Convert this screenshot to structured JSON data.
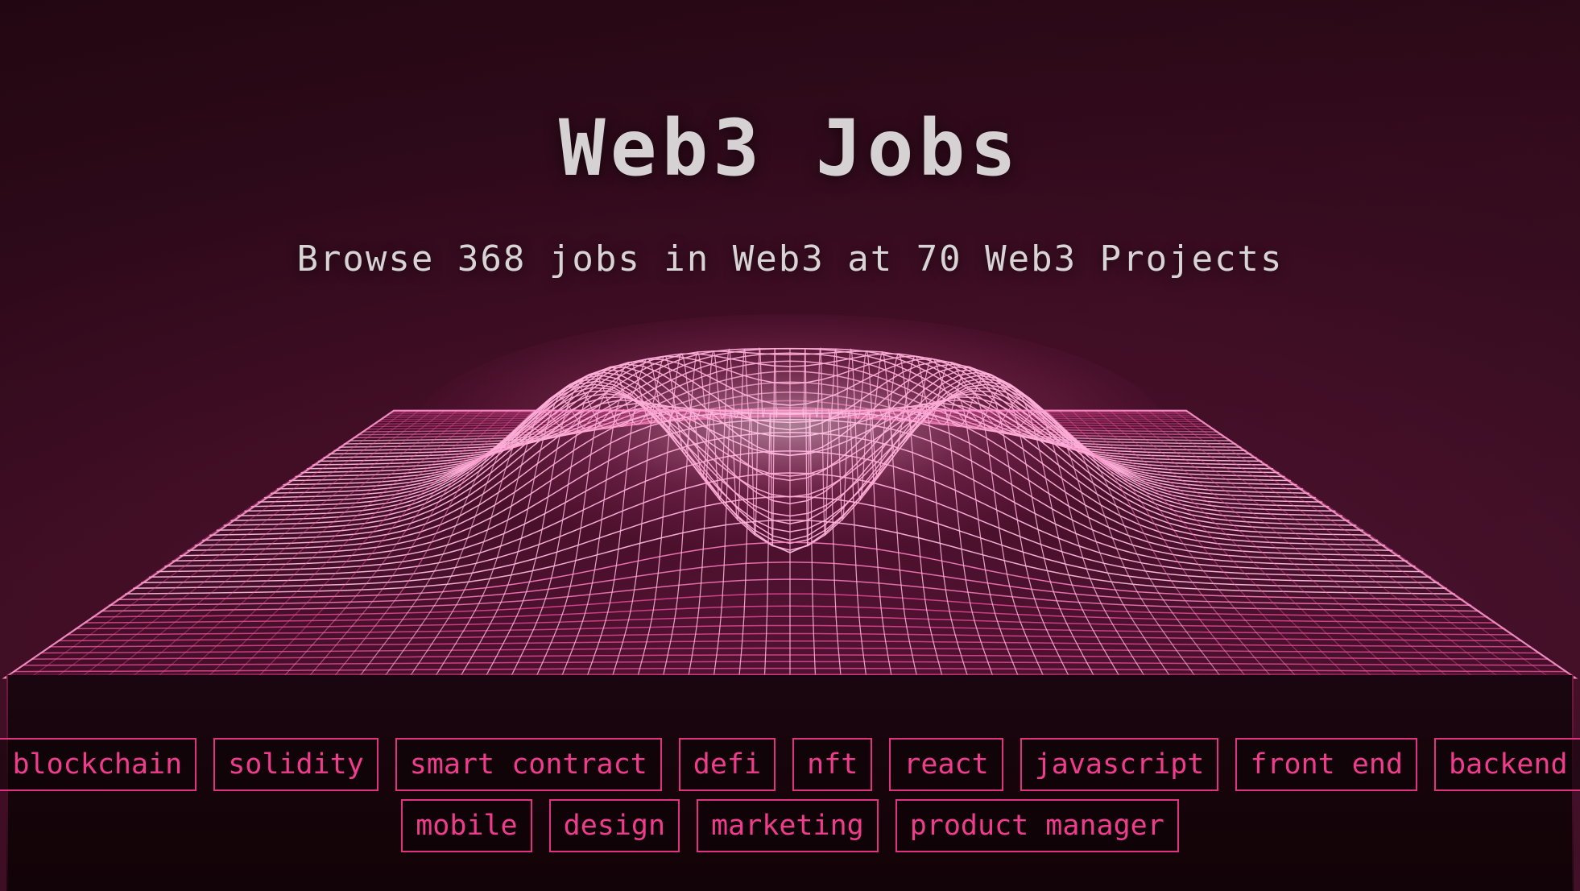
{
  "page": {
    "title": "Web3 Jobs",
    "subtitle": "Browse 368 jobs in Web3 at 70 Web3 Projects",
    "job_count": 368,
    "project_count": 70
  },
  "colors": {
    "background": "#1d0610",
    "title_text": "#d6d2d3",
    "subtitle_text": "#d8d4d5",
    "tag_border": "#e0327f",
    "tag_text": "#ef3c8c",
    "mesh_pink": "#ef4d9e",
    "mesh_highlight": "#ffc7e6"
  },
  "tags": {
    "row1": [
      {
        "label": "blockchain"
      },
      {
        "label": "solidity"
      },
      {
        "label": "smart contract"
      },
      {
        "label": "defi"
      },
      {
        "label": "nft"
      },
      {
        "label": "react"
      },
      {
        "label": "javascript"
      },
      {
        "label": "front end"
      },
      {
        "label": "backend"
      }
    ],
    "row2": [
      {
        "label": "mobile"
      },
      {
        "label": "design"
      },
      {
        "label": "marketing"
      },
      {
        "label": "product manager"
      }
    ]
  },
  "graphic": {
    "name": "3d-wireframe-terrain",
    "description": "pink perspective wireframe grid plane with a central crater/volcano surface"
  }
}
